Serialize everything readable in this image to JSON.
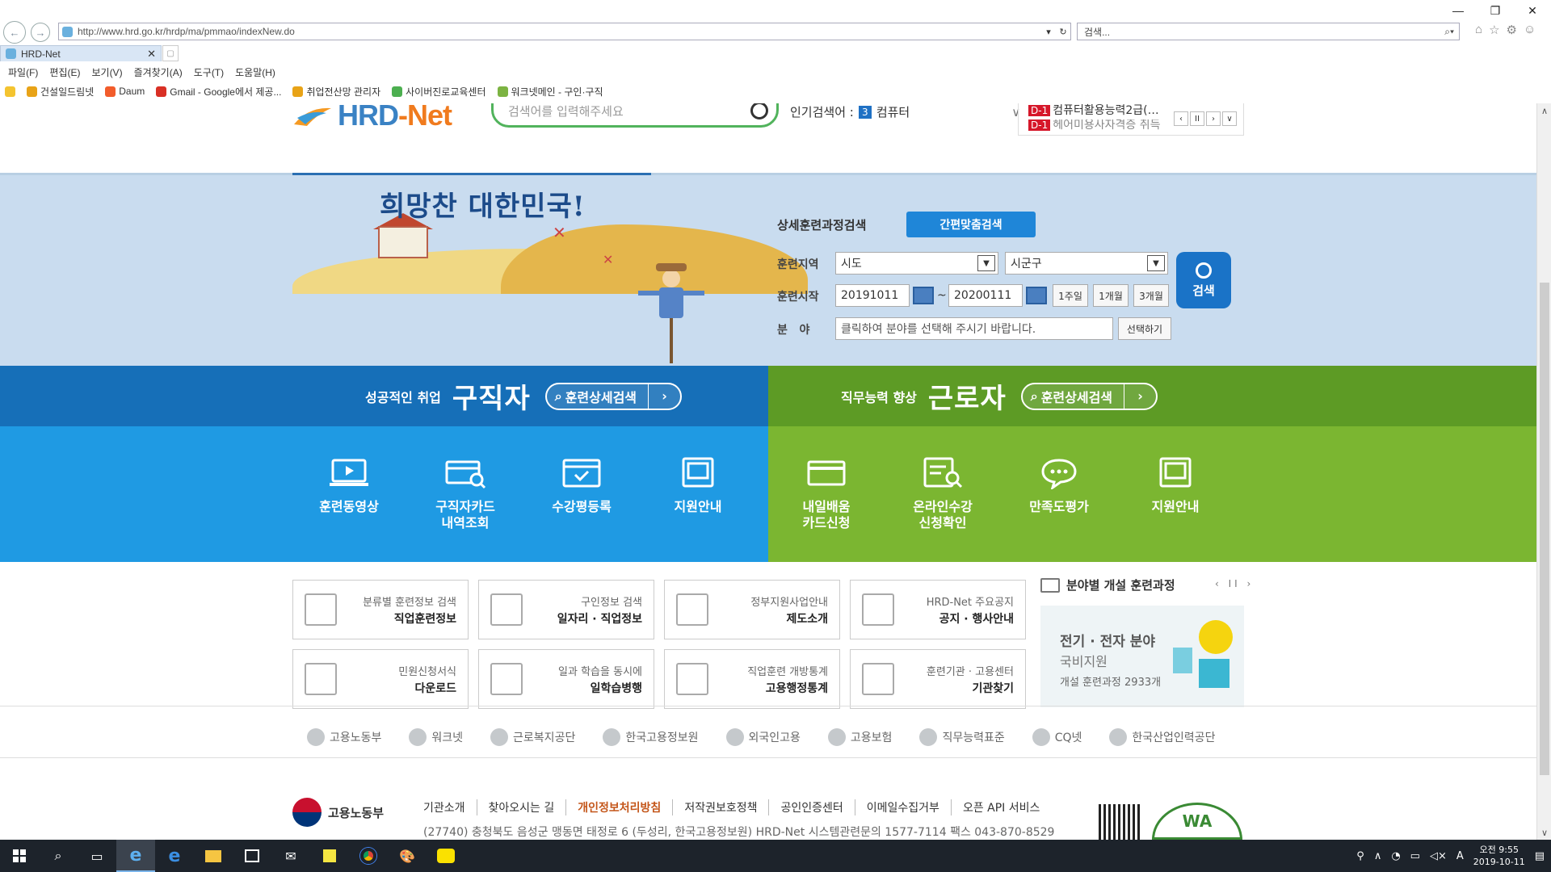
{
  "browser": {
    "url": "http://www.hrd.go.kr/hrdp/ma/pmmao/indexNew.do",
    "search_placeholder": "검색...",
    "tab_title": "HRD-Net",
    "menu": [
      "파일(F)",
      "편집(E)",
      "보기(V)",
      "즐겨찾기(A)",
      "도구(T)",
      "도움말(H)"
    ],
    "favorites": [
      "건설일드림넷",
      "Daum",
      "Gmail - Google에서 제공...",
      "취업전산망 관리자",
      "사이버진로교육센터",
      "워크넷메인 - 구인·구직"
    ]
  },
  "header": {
    "logo_hrd": "HRD",
    "logo_net": "-Net",
    "search_placeholder": "검색어를 입력해주세요",
    "popular_label": "인기검색어 :",
    "popular_rank": "3",
    "popular_term": "컴퓨터",
    "dday_badge": "D-1",
    "dday_text": "컴퓨터활용능력2급(…",
    "dday_text2": "헤어미용사자격증 취득"
  },
  "banner": {
    "slogan": "희망찬 대한민국!",
    "ds_title": "상세훈련과정검색",
    "quick_search": "간편맞춤검색",
    "region_label": "훈련지역",
    "region_sido": "시도",
    "region_sigungu": "시군구",
    "start_label": "훈련시작",
    "start_from": "20191011",
    "tilde": "~",
    "start_to": "20200111",
    "period_buttons": [
      "1주일",
      "1개월",
      "3개월"
    ],
    "field_label": "분   야",
    "field_placeholder": "클릭하여 분야를 선택해 주시기 바랍니다.",
    "select_button": "선택하기",
    "search_button": "검색"
  },
  "jobseeker": {
    "small": "성공적인 취업",
    "big": "구직자",
    "pill": "훈련상세검색",
    "items": [
      "훈련동영상",
      "구직자카드\n내역조회",
      "수강평등록",
      "지원안내"
    ]
  },
  "worker": {
    "small": "직무능력 향상",
    "big": "근로자",
    "pill": "훈련상세검색",
    "items": [
      "내일배움\n카드신청",
      "온라인수강\n신청확인",
      "만족도평가",
      "지원안내"
    ]
  },
  "quick": [
    {
      "s": "분류별 훈련정보 검색",
      "b": "직업훈련정보"
    },
    {
      "s": "구인정보 검색",
      "b": "일자리 · 직업정보"
    },
    {
      "s": "정부지원사업안내",
      "b": "제도소개"
    },
    {
      "s": "HRD-Net 주요공지",
      "b": "공지 · 행사안내"
    },
    {
      "s": "민원신청서식",
      "b": "다운로드"
    },
    {
      "s": "일과 학습을 동시에",
      "b": "일학습병행"
    },
    {
      "s": "직업훈련 개방통계",
      "b": "고용행정통계"
    },
    {
      "s": "훈련기관 · 고용센터",
      "b": "기관찾기"
    }
  ],
  "field_box": {
    "title": "분야별 개설 훈련과정",
    "ctrl": "‹ II ›",
    "t1": "전기 · 전자 분야",
    "t2": "국비지원",
    "t3": "개설 훈련과정 2933개"
  },
  "partners": [
    "고용노동부",
    "워크넷",
    "근로복지공단",
    "한국고용정보원",
    "외국인고용",
    "고용보험",
    "직무능력표준",
    "CQ넷",
    "한국산업인력공단"
  ],
  "footer": {
    "ministry": "고용노동부",
    "links": [
      "기관소개",
      "찾아오시는 길",
      "개인정보처리방침",
      "저작권보호정책",
      "공인인증센터",
      "이메일수집거부",
      "오픈 API 서비스"
    ],
    "address": "(27740) 충청북도 음성군 맹동면 태정로 6 (두성리, 한국고용정보원) HRD-Net 시스템관련문의 1577-7114   팩스 043-870-8529",
    "wa": "WA"
  },
  "taskbar": {
    "time": "오전 9:55",
    "date": "2019-10-11",
    "ime": "A"
  }
}
